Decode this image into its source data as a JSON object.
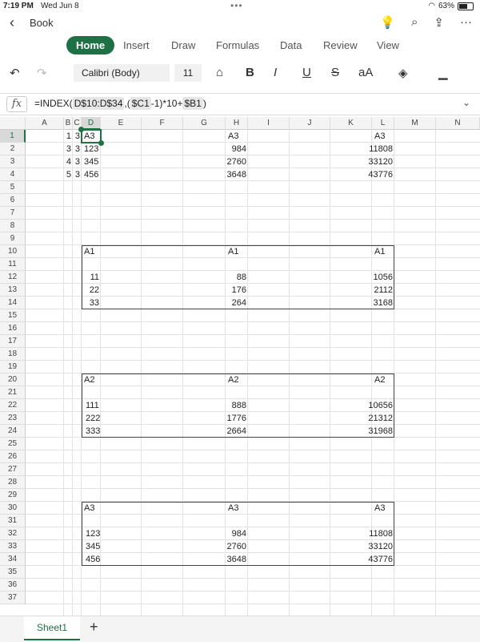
{
  "status": {
    "time": "7:19 PM",
    "date": "Wed Jun 8",
    "battery": "63%",
    "battery_level": 0.63
  },
  "app": {
    "doc_title": "Book"
  },
  "tabs": [
    "Home",
    "Insert",
    "Draw",
    "Formulas",
    "Data",
    "Review",
    "View"
  ],
  "toolbar": {
    "font": "Calibri (Body)",
    "size": "11",
    "bold": "B",
    "italic": "I",
    "underline": "U",
    "strike": "S",
    "fontsize_menu": "aA"
  },
  "formula_bar": {
    "fx": "fx",
    "parts": [
      "=INDEX(",
      "D$10:D$34",
      ",(",
      "$C1",
      "-1)*10+",
      "$B1",
      ")"
    ]
  },
  "columns": [
    "A",
    "B",
    "C",
    "D",
    "E",
    "F",
    "G",
    "H",
    "I",
    "J",
    "K",
    "L",
    "M",
    "N"
  ],
  "rows": [
    1,
    2,
    3,
    4,
    5,
    6,
    7,
    8,
    9,
    10,
    11,
    12,
    13,
    14,
    15,
    16,
    17,
    18,
    19,
    20,
    21,
    22,
    23,
    24,
    25,
    26,
    27,
    28,
    29,
    30,
    31,
    32,
    33,
    34,
    35,
    36,
    37
  ],
  "cells": [
    {
      "r": 1,
      "c": "B",
      "v": "1",
      "num": true
    },
    {
      "r": 1,
      "c": "C",
      "v": "3",
      "num": true
    },
    {
      "r": 1,
      "c": "D",
      "v": "A3"
    },
    {
      "r": 1,
      "c": "H",
      "v": "A3"
    },
    {
      "r": 1,
      "c": "L",
      "v": "A3"
    },
    {
      "r": 2,
      "c": "B",
      "v": "3",
      "num": true
    },
    {
      "r": 2,
      "c": "C",
      "v": "3",
      "num": true
    },
    {
      "r": 2,
      "c": "D",
      "v": "123"
    },
    {
      "r": 2,
      "c": "H",
      "v": "984",
      "num": true
    },
    {
      "r": 2,
      "c": "L",
      "v": "11808",
      "num": true
    },
    {
      "r": 3,
      "c": "B",
      "v": "4",
      "num": true
    },
    {
      "r": 3,
      "c": "C",
      "v": "3",
      "num": true
    },
    {
      "r": 3,
      "c": "D",
      "v": "345"
    },
    {
      "r": 3,
      "c": "H",
      "v": "2760",
      "num": true
    },
    {
      "r": 3,
      "c": "L",
      "v": "33120",
      "num": true
    },
    {
      "r": 4,
      "c": "B",
      "v": "5",
      "num": true
    },
    {
      "r": 4,
      "c": "C",
      "v": "3",
      "num": true
    },
    {
      "r": 4,
      "c": "D",
      "v": "456"
    },
    {
      "r": 4,
      "c": "H",
      "v": "3648",
      "num": true
    },
    {
      "r": 4,
      "c": "L",
      "v": "43776",
      "num": true
    },
    {
      "r": 10,
      "c": "D",
      "v": "A1"
    },
    {
      "r": 10,
      "c": "H",
      "v": "A1"
    },
    {
      "r": 10,
      "c": "L",
      "v": "A1"
    },
    {
      "r": 12,
      "c": "D",
      "v": "11",
      "num": true
    },
    {
      "r": 12,
      "c": "H",
      "v": "88",
      "num": true
    },
    {
      "r": 12,
      "c": "L",
      "v": "1056",
      "num": true
    },
    {
      "r": 13,
      "c": "D",
      "v": "22",
      "num": true
    },
    {
      "r": 13,
      "c": "H",
      "v": "176",
      "num": true
    },
    {
      "r": 13,
      "c": "L",
      "v": "2112",
      "num": true
    },
    {
      "r": 14,
      "c": "D",
      "v": "33",
      "num": true
    },
    {
      "r": 14,
      "c": "H",
      "v": "264",
      "num": true
    },
    {
      "r": 14,
      "c": "L",
      "v": "3168",
      "num": true
    },
    {
      "r": 20,
      "c": "D",
      "v": "A2"
    },
    {
      "r": 20,
      "c": "H",
      "v": "A2"
    },
    {
      "r": 20,
      "c": "L",
      "v": "A2"
    },
    {
      "r": 22,
      "c": "D",
      "v": "111",
      "num": true
    },
    {
      "r": 22,
      "c": "H",
      "v": "888",
      "num": true
    },
    {
      "r": 22,
      "c": "L",
      "v": "10656",
      "num": true
    },
    {
      "r": 23,
      "c": "D",
      "v": "222",
      "num": true
    },
    {
      "r": 23,
      "c": "H",
      "v": "1776",
      "num": true
    },
    {
      "r": 23,
      "c": "L",
      "v": "21312",
      "num": true
    },
    {
      "r": 24,
      "c": "D",
      "v": "333",
      "num": true
    },
    {
      "r": 24,
      "c": "H",
      "v": "2664",
      "num": true
    },
    {
      "r": 24,
      "c": "L",
      "v": "31968",
      "num": true
    },
    {
      "r": 30,
      "c": "D",
      "v": "A3"
    },
    {
      "r": 30,
      "c": "H",
      "v": "A3"
    },
    {
      "r": 30,
      "c": "L",
      "v": "A3"
    },
    {
      "r": 32,
      "c": "D",
      "v": "123",
      "num": true
    },
    {
      "r": 32,
      "c": "H",
      "v": "984",
      "num": true
    },
    {
      "r": 32,
      "c": "L",
      "v": "11808",
      "num": true
    },
    {
      "r": 33,
      "c": "D",
      "v": "345",
      "num": true
    },
    {
      "r": 33,
      "c": "H",
      "v": "2760",
      "num": true
    },
    {
      "r": 33,
      "c": "L",
      "v": "33120",
      "num": true
    },
    {
      "r": 34,
      "c": "D",
      "v": "456",
      "num": true
    },
    {
      "r": 34,
      "c": "H",
      "v": "3648",
      "num": true
    },
    {
      "r": 34,
      "c": "L",
      "v": "43776",
      "num": true
    }
  ],
  "boxes": [
    {
      "r1": 10,
      "r2": 14
    },
    {
      "r1": 20,
      "r2": 24
    },
    {
      "r1": 30,
      "r2": 34
    }
  ],
  "selected": {
    "r": 1,
    "c": "D"
  },
  "sheets": {
    "tab": "Sheet1",
    "add": "+"
  }
}
